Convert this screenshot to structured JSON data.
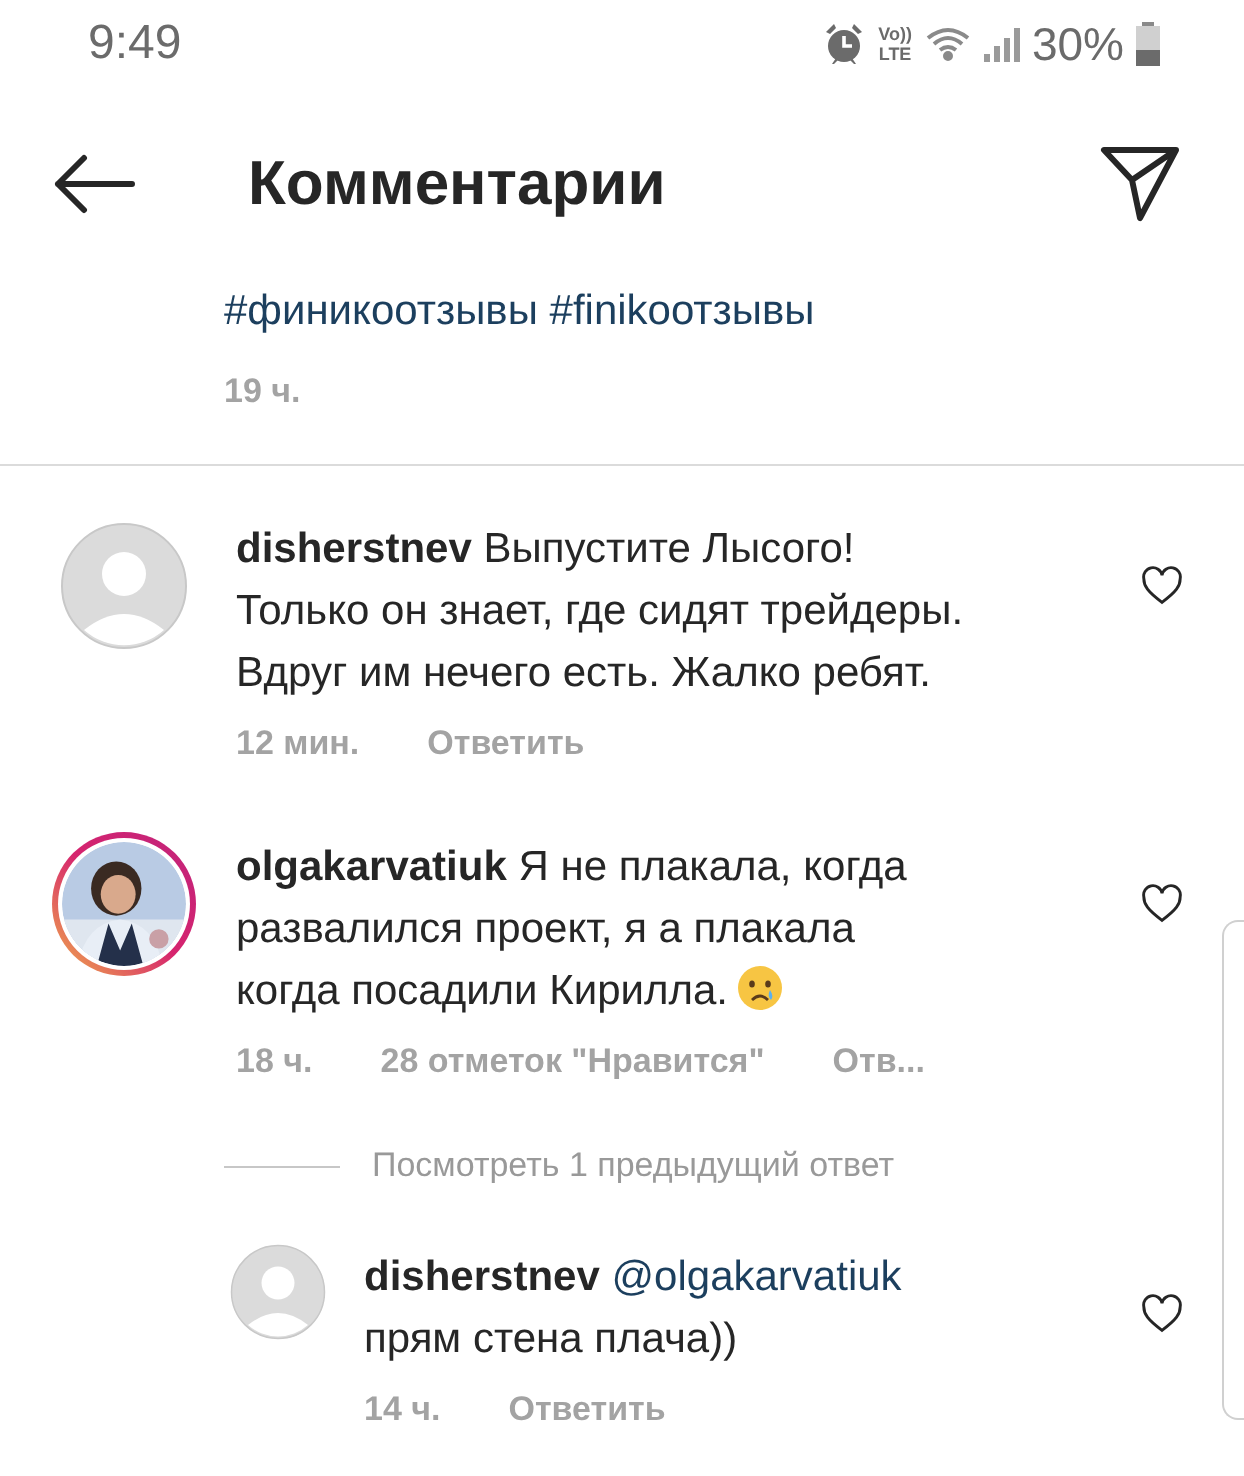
{
  "status_bar": {
    "time": "9:49",
    "volte_top": "Vo))",
    "volte_bottom": "LTE",
    "battery": "30%"
  },
  "header": {
    "title": "Комментарии"
  },
  "caption": {
    "hashtags": "#финикоотзывы #finikoотзывы",
    "time": "19 ч."
  },
  "comments": [
    {
      "username": "disherstnev",
      "text_lines": [
        "Выпустите Лысого!",
        "Только он знает, где сидят трейдеры.",
        "Вдруг им нечего есть. Жалко ребят."
      ],
      "has_photo": false,
      "story_ring": false,
      "time": "12 мин.",
      "reply": "Ответить",
      "liked": false
    },
    {
      "username": "olgakarvatiuk",
      "text_lines": [
        "Я не плакала, когда",
        "развалился проект, я а плакала",
        "когда посадили Кирилла."
      ],
      "has_photo": true,
      "story_ring": true,
      "time": "18 ч.",
      "likes": "28 отметок \"Нравится\"",
      "reply": "Отв...",
      "liked": false,
      "crying_emoji": true,
      "view_replies": "Посмотреть 1 предыдущий ответ",
      "replies": [
        {
          "username": "disherstnev",
          "mention": "@olgakarvatiuk",
          "text_lines": [
            "прям стена плача))"
          ],
          "has_photo": false,
          "story_ring": false,
          "time": "14 ч.",
          "reply": "Ответить",
          "liked": false
        }
      ]
    }
  ]
}
